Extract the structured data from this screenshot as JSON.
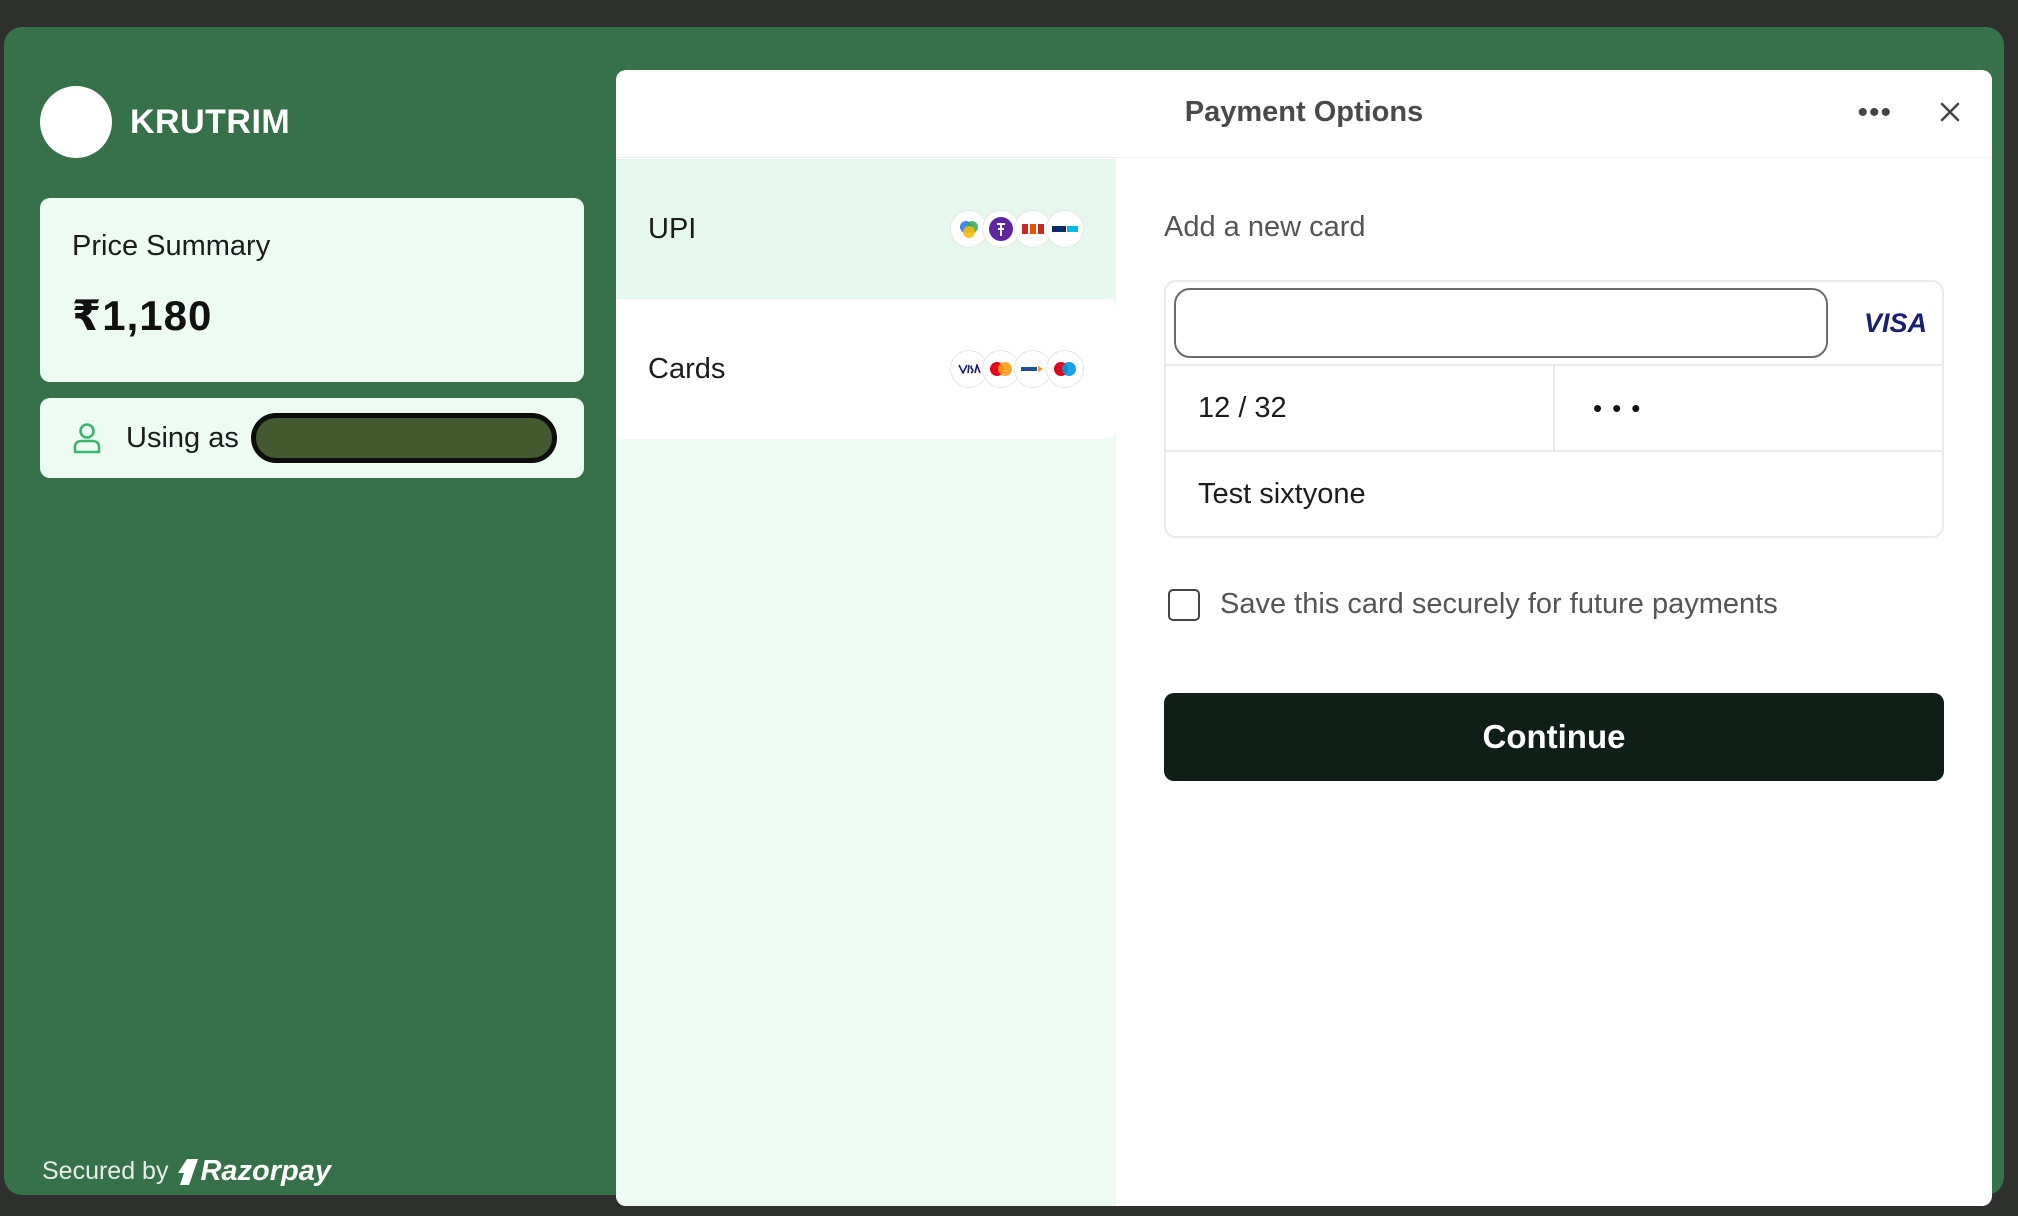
{
  "brand": {
    "name": "KRUTRIM"
  },
  "summary": {
    "title": "Price Summary",
    "amount": "₹1,180"
  },
  "user": {
    "label": "Using as"
  },
  "footer": {
    "secured_by": "Secured by",
    "provider": "Razorpay"
  },
  "header": {
    "title": "Payment Options",
    "more": "•••"
  },
  "methods": [
    {
      "label": "UPI",
      "icons": [
        "google-pay-icon",
        "phonepe-icon",
        "bhim-icon",
        "paytm-icon"
      ]
    },
    {
      "label": "Cards",
      "icons": [
        "visa-icon",
        "mastercard-icon",
        "rupay-icon",
        "maestro-icon"
      ]
    }
  ],
  "card_form": {
    "title": "Add a new card",
    "number_value": "",
    "network": "VISA",
    "expiry": "12 / 32",
    "cvv_masked": "•••",
    "name": "Test sixtyone",
    "save_label": "Save this card securely for future payments",
    "save_checked": false,
    "continue_label": "Continue"
  },
  "colors": {
    "frame": "#37714a",
    "panel_tint": "#edfbf3",
    "continue": "#0f1f17",
    "visa": "#1a1f71"
  }
}
